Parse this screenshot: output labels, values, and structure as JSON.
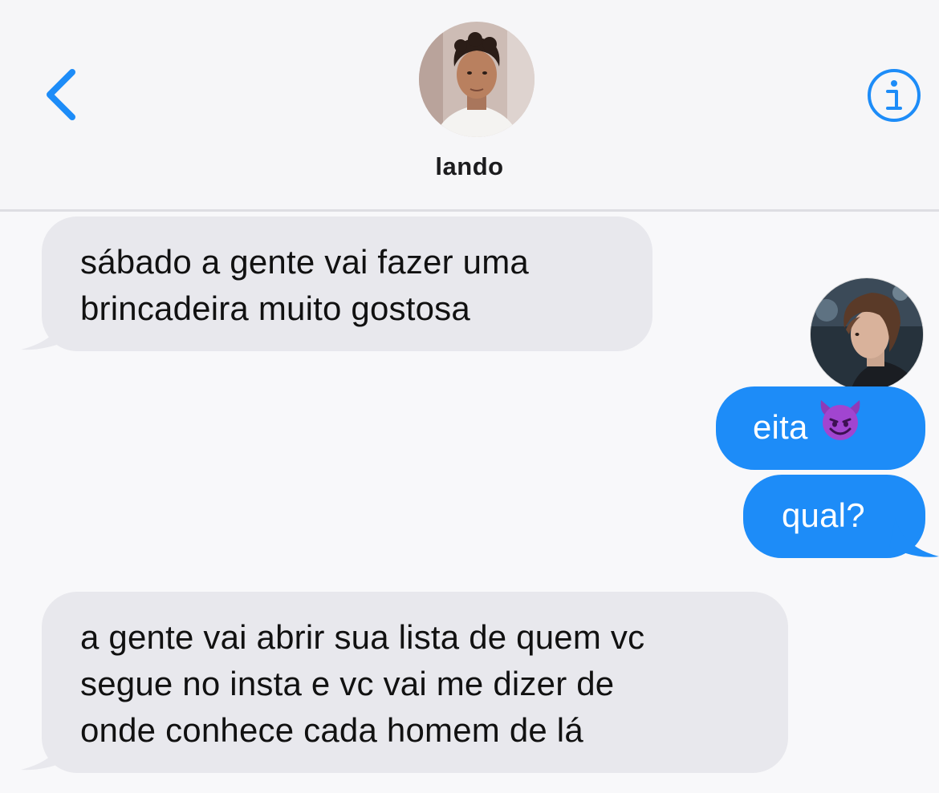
{
  "header": {
    "contact_name": "lando",
    "back_icon": "chevron-left-icon",
    "info_icon": "info-circle-icon",
    "accent_color": "#1d8cf8"
  },
  "messages": [
    {
      "direction": "incoming",
      "text": "sábado a gente vai fazer uma\nbrincadeira muito gostosa"
    },
    {
      "direction": "outgoing",
      "text": "eita",
      "emoji": "smiling-devil-emoji"
    },
    {
      "direction": "outgoing",
      "text": "qual?"
    },
    {
      "direction": "incoming",
      "text": "a gente vai abrir sua lista de quem vc\nsegue no insta e vc vai me dizer de\nonde conhece cada homem de lá"
    }
  ],
  "colors": {
    "incoming_bubble": "#e8e8ed",
    "outgoing_bubble": "#1d8cf8",
    "background": "#f8f8fa"
  }
}
